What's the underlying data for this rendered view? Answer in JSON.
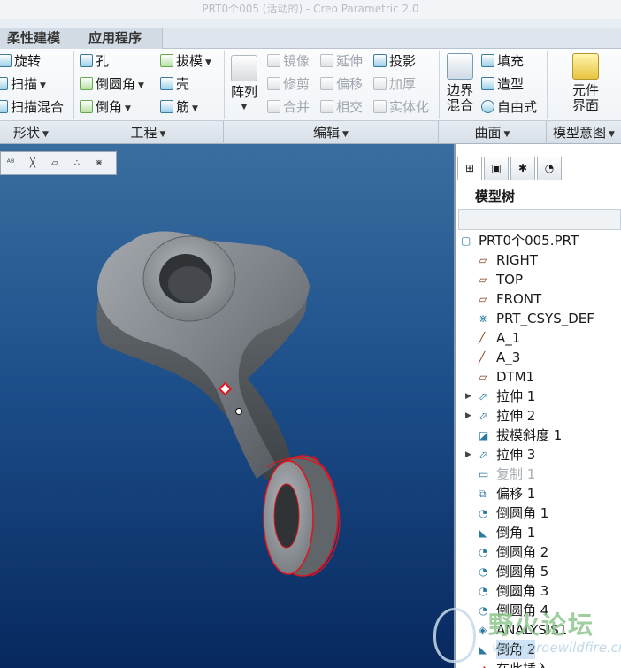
{
  "window": {
    "title": "PRT0个005 (活动的) - Creo Parametric 2.0"
  },
  "tabs": [
    "柔性建模",
    "应用程序"
  ],
  "ribbon": {
    "shape": {
      "revolve": "旋转",
      "sweep": "扫描",
      "swept_blend": "扫描混合"
    },
    "engineering": {
      "hole": "孔",
      "round": "倒圆角",
      "chamfer": "倒角",
      "draft": "拔模",
      "shell": "壳",
      "rib": "筋"
    },
    "editing": {
      "pattern": "阵列",
      "mirror": "镜像",
      "trim": "修剪",
      "merge": "合并",
      "extend": "延伸",
      "offset": "偏移",
      "intersect": "相交",
      "project": "投影",
      "thicken": "加厚",
      "solidify": "实体化"
    },
    "surfaces": {
      "boundary_blend_line1": "边界",
      "boundary_blend_line2": "混合",
      "fill": "填充",
      "style": "造型",
      "freeform": "自由式"
    },
    "model_intent": {
      "component_interface_line1": "元件",
      "component_interface_line2": "界面"
    },
    "groups": [
      "形状",
      "工程",
      "编辑",
      "曲面",
      "模型意图"
    ]
  },
  "view_toolbar": {
    "icons": [
      "annotation-display-icon",
      "axis-display-icon",
      "plane-display-icon",
      "point-display-icon",
      "csys-display-icon"
    ]
  },
  "model_tree": {
    "title": "模型树",
    "items": [
      {
        "label": "PRT0个005.PRT",
        "icon": "part-icon",
        "level": 0,
        "expandable": false,
        "state": "normal"
      },
      {
        "label": "RIGHT",
        "icon": "datum-plane-icon",
        "level": 1,
        "expandable": false,
        "state": "normal"
      },
      {
        "label": "TOP",
        "icon": "datum-plane-icon",
        "level": 1,
        "expandable": false,
        "state": "normal"
      },
      {
        "label": "FRONT",
        "icon": "datum-plane-icon",
        "level": 1,
        "expandable": false,
        "state": "normal"
      },
      {
        "label": "PRT_CSYS_DEF",
        "icon": "csys-icon",
        "level": 1,
        "expandable": false,
        "state": "normal"
      },
      {
        "label": "A_1",
        "icon": "datum-axis-icon",
        "level": 1,
        "expandable": false,
        "state": "normal"
      },
      {
        "label": "A_3",
        "icon": "datum-axis-icon",
        "level": 1,
        "expandable": false,
        "state": "normal"
      },
      {
        "label": "DTM1",
        "icon": "datum-plane-icon",
        "level": 1,
        "expandable": false,
        "state": "normal"
      },
      {
        "label": "拉伸 1",
        "icon": "extrude-icon",
        "level": 1,
        "expandable": true,
        "state": "normal"
      },
      {
        "label": "拉伸 2",
        "icon": "extrude-icon",
        "level": 1,
        "expandable": true,
        "state": "normal"
      },
      {
        "label": "拔模斜度 1",
        "icon": "draft-icon",
        "level": 1,
        "expandable": false,
        "state": "normal"
      },
      {
        "label": "拉伸 3",
        "icon": "extrude-icon",
        "level": 1,
        "expandable": true,
        "state": "normal"
      },
      {
        "label": "复制 1",
        "icon": "copy-icon",
        "level": 1,
        "expandable": false,
        "state": "suppressed"
      },
      {
        "label": "偏移 1",
        "icon": "offset-icon",
        "level": 1,
        "expandable": false,
        "state": "normal"
      },
      {
        "label": "倒圆角 1",
        "icon": "round-icon",
        "level": 1,
        "expandable": false,
        "state": "normal"
      },
      {
        "label": "倒角 1",
        "icon": "chamfer-icon",
        "level": 1,
        "expandable": false,
        "state": "normal"
      },
      {
        "label": "倒圆角 2",
        "icon": "round-icon",
        "level": 1,
        "expandable": false,
        "state": "normal"
      },
      {
        "label": "倒圆角 5",
        "icon": "round-icon",
        "level": 1,
        "expandable": false,
        "state": "normal"
      },
      {
        "label": "倒圆角 3",
        "icon": "round-icon",
        "level": 1,
        "expandable": false,
        "state": "normal"
      },
      {
        "label": "倒圆角 4",
        "icon": "round-icon",
        "level": 1,
        "expandable": false,
        "state": "normal"
      },
      {
        "label": "ANALYSIS1",
        "icon": "analysis-icon",
        "level": 1,
        "expandable": false,
        "state": "normal"
      },
      {
        "label": "倒角 2",
        "icon": "chamfer-icon",
        "level": 1,
        "expandable": false,
        "state": "selected"
      },
      {
        "label": "在此插入",
        "icon": "insert-here-icon",
        "level": 1,
        "expandable": false,
        "state": "normal"
      }
    ]
  },
  "watermark": {
    "text": "野火论坛",
    "url": "www.proewildfire.cn"
  },
  "colors": {
    "viewport_top": "#3a6ea0",
    "viewport_bottom": "#07285f",
    "model_gray": "#7d8288",
    "highlight_red": "#e0141e",
    "panel_border": "#8d9baa"
  }
}
